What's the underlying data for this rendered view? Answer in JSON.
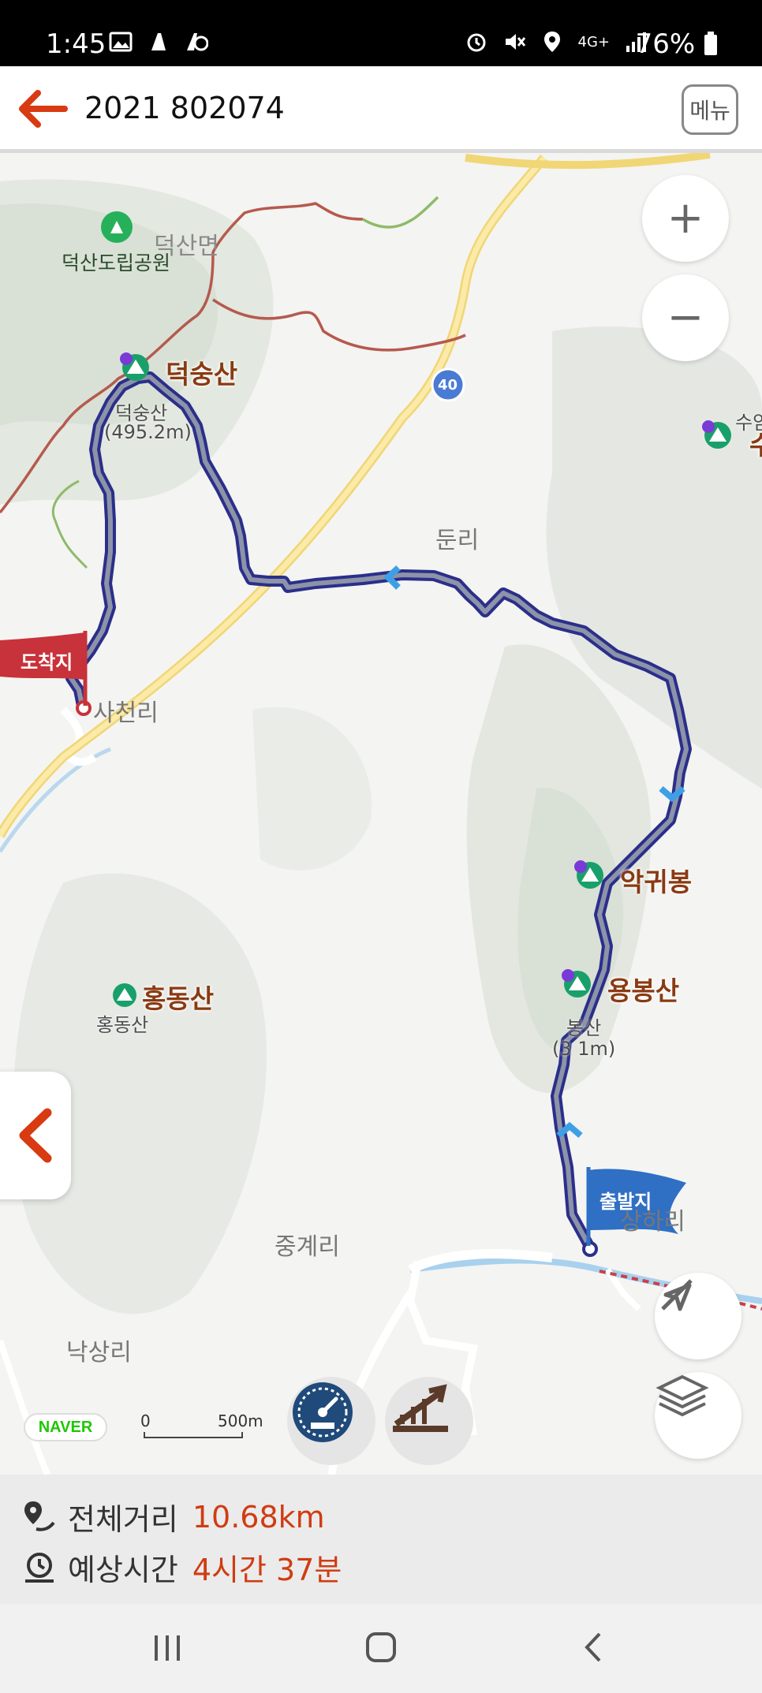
{
  "status_bar": {
    "time": "1:45",
    "battery": "76%",
    "network": "4G+",
    "left_icons": [
      "image-icon",
      "notification-icon",
      "notification-icon"
    ],
    "right_icons": [
      "alarm-icon",
      "mute-icon",
      "location-icon",
      "signal-icon",
      "battery-icon"
    ]
  },
  "header": {
    "title": "2021 802074",
    "menu_label": "메뉴",
    "back_icon": "arrow-left-icon"
  },
  "map": {
    "places": {
      "deoksan_myeon": "덕산면",
      "deoksan_park": "덕산도립공원",
      "dunri": "둔리",
      "sacheonri": "사천리",
      "junggyeri": "중계리",
      "naksangri": "낙상리",
      "sangari": "상하리"
    },
    "peaks": {
      "deoksungsan": "덕숭산",
      "deoksungsan_sub": "덕숭산",
      "deoksungsan_elev": "(495.2m)",
      "akgwibong": "악귀봉",
      "yongbongsan": "용봉산",
      "yongbongsan_sub": "봉산",
      "yongbongsan_elev": "(3  1m)",
      "hongdongsan": "홍동산",
      "hongdongsan_sub": "홍동산",
      "suam_partial": "수암",
      "partial_char": "수"
    },
    "road_number": "40",
    "flags": {
      "start": "출발지",
      "end": "도착지"
    },
    "controls": {
      "zoom_in": "+",
      "zoom_out": "−"
    },
    "naver_logo": "NAVER",
    "scale": {
      "zero": "0",
      "distance": "500m"
    }
  },
  "route_info": {
    "distance_label": "전체거리",
    "distance_value": "10.68km",
    "time_label": "예상시간",
    "time_value": "4시간 37분"
  },
  "colors": {
    "route": "#3b43b5",
    "accent": "#d03c12",
    "start_flag": "#2f6fc4",
    "end_flag": "#c8323a"
  }
}
